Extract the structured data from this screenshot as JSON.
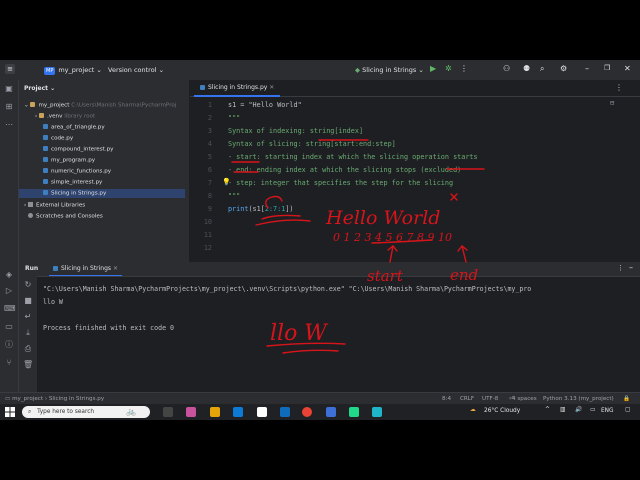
{
  "titlebar": {
    "project_badge": "MP",
    "project": "my_project",
    "vcs": "Version control",
    "run_config": "Slicing in Strings"
  },
  "project_panel": {
    "header": "Project",
    "root_name": "my_project",
    "root_path": "C:\\Users\\Manish Sharma\\PycharmProj",
    "items": [
      {
        "label": ".venv",
        "note": "library root",
        "kind": "folder"
      },
      {
        "label": "area_of_triangle.py",
        "kind": "py"
      },
      {
        "label": "code.py",
        "kind": "py"
      },
      {
        "label": "compound_interest.py",
        "kind": "py"
      },
      {
        "label": "my_program.py",
        "kind": "py"
      },
      {
        "label": "numeric_functions.py",
        "kind": "py"
      },
      {
        "label": "simple_interest.py",
        "kind": "py"
      },
      {
        "label": "Slicing in Strings.py",
        "kind": "py"
      }
    ],
    "external_libraries": "External Libraries",
    "scratches": "Scratches and Consoles"
  },
  "editor": {
    "tab": "Slicing in Strings.py",
    "line_numbers": [
      "1",
      "2",
      "3",
      "4",
      "5",
      "6",
      "7",
      "8",
      "9",
      "10",
      "11",
      "12"
    ],
    "line1": "s1 = \"Hello World\"",
    "line2": "\"\"\"",
    "line3": "Syntax of indexing: string[index]",
    "line4": "Syntax of slicing: string[start:end:step]",
    "line5": "- start: starting index at which the slicing operation starts",
    "line6": "- end: ending index at which the slicing stops (excluded)",
    "line7": "- step: integer that specifies the step for the slicing",
    "line8": "\"\"\"",
    "line9_fn": "print",
    "line9_open": "(s1[",
    "line9_args": "2:7:1",
    "line9_close": "])"
  },
  "run": {
    "tab_label": "Run",
    "config": "Slicing in Strings",
    "command": "\"C:\\Users\\Manish Sharma\\PycharmProjects\\my_project\\.venv\\Scripts\\python.exe\" \"C:\\Users\\Manish Sharma\\PycharmProjects\\my_pro",
    "output": "llo W",
    "finished": "Process finished with exit code 0"
  },
  "annotations": {
    "hello_world": "Hello World",
    "indices": "0 1 2 3 4 5 6 7 8 9 10",
    "start": "start",
    "end": "end",
    "output_note": "llo W"
  },
  "statusbar": {
    "breadcrumb_project": "my_project",
    "breadcrumb_file": "Slicing in Strings.py",
    "position": "8:4",
    "line_ending": "CRLF",
    "encoding": "UTF-8",
    "indent": "4 spaces",
    "interpreter": "Python 3.13 (my_project)"
  },
  "taskbar": {
    "search_placeholder": "Type here to search",
    "weather": "26°C  Cloudy",
    "language": "ENG"
  },
  "colors": {
    "accent": "#3574f0",
    "ink_red": "#d8141b",
    "string_green": "#6aab73",
    "keyword_orange": "#cf8e6d"
  }
}
